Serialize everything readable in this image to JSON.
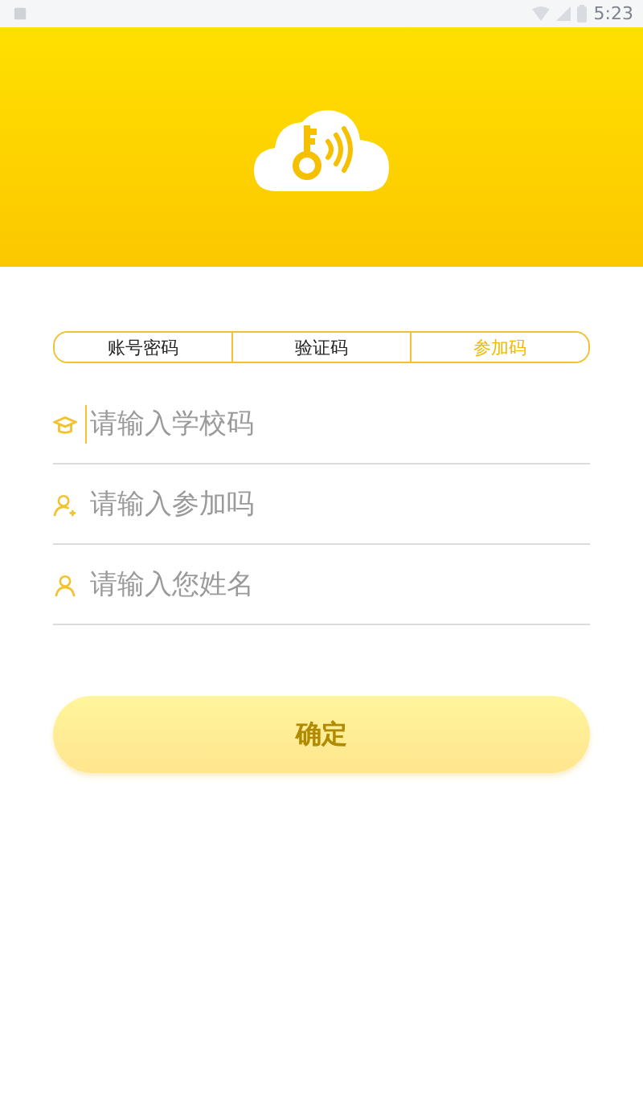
{
  "status_bar": {
    "time": "5:23"
  },
  "tabs": [
    {
      "label": "账号密码",
      "selected": false
    },
    {
      "label": "验证码",
      "selected": false
    },
    {
      "label": "参加码",
      "selected": true
    }
  ],
  "fields": [
    {
      "kind": "school",
      "placeholder": "请输入学校码",
      "focused": true
    },
    {
      "kind": "person-add",
      "placeholder": "请输入参加吗",
      "focused": false
    },
    {
      "kind": "person",
      "placeholder": "请输入您姓名",
      "focused": false
    }
  ],
  "submit": {
    "label": "确定",
    "disabled": true
  }
}
